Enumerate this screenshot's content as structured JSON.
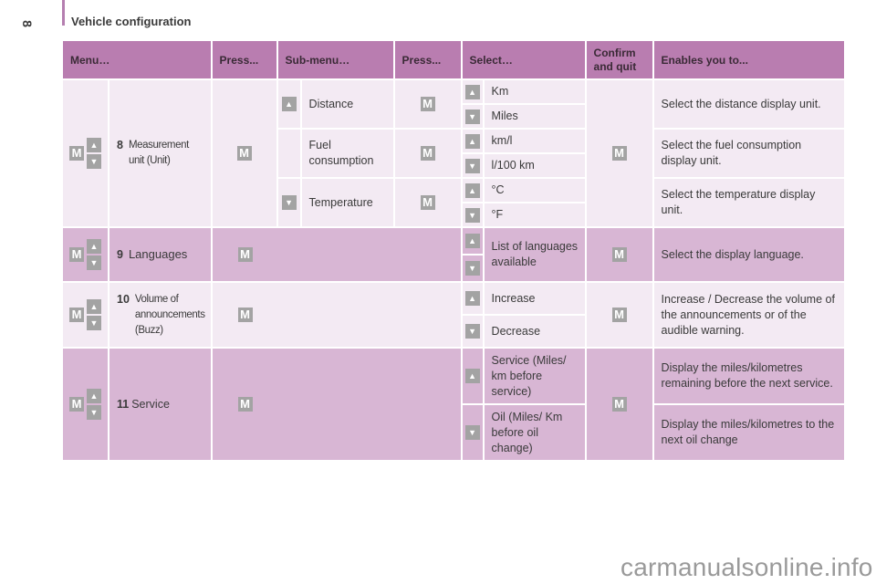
{
  "page": {
    "section_title": "Vehicle configuration",
    "page_number": "8",
    "watermark": "carmanualsonline.info"
  },
  "icons": {
    "m_label": "M",
    "up_glyph": "▲",
    "down_glyph": "▼"
  },
  "table": {
    "headers": {
      "menu": "Menu…",
      "press1": "Press...",
      "submenu": "Sub-menu…",
      "press2": "Press...",
      "select": "Select…",
      "confirm": "Confirm and quit",
      "enables": "Enables you to..."
    },
    "rows": {
      "measurement": {
        "number": "8",
        "label": "Measurement unit (Unit)",
        "submenus": {
          "distance": {
            "label": "Distance",
            "options": [
              "Km",
              "Miles"
            ],
            "enables": "Select the distance display unit."
          },
          "fuel": {
            "label": "Fuel consumption",
            "options": [
              "km/l",
              "l/100 km"
            ],
            "enables": "Select the fuel consumption display unit."
          },
          "temperature": {
            "label": "Temperature",
            "options": [
              "°C",
              "°F"
            ],
            "enables": "Select the temperature display unit."
          }
        }
      },
      "languages": {
        "number": "9",
        "label": "Languages",
        "select": "List of languages available",
        "enables": "Select the display language."
      },
      "volume": {
        "number": "10",
        "label": "Volume of announcements (Buzz)",
        "options": [
          "Increase",
          "Decrease"
        ],
        "enables": "Increase / Decrease the volume of the announcements or of the audible warning."
      },
      "service": {
        "number": "11",
        "label": "Service",
        "options": [
          "Service (Miles/ km before service)",
          "Oil (Miles/ Km before oil change)"
        ],
        "enables": [
          "Display the miles/kilometres remaining before the next service.",
          "Display the miles/kilometres to the next oil change"
        ]
      }
    }
  },
  "colors": {
    "header_bg": "#b97db0",
    "row_light": "#f3eaf3",
    "row_dark": "#d8b6d4",
    "icon_gray": "#a3a3a3"
  }
}
